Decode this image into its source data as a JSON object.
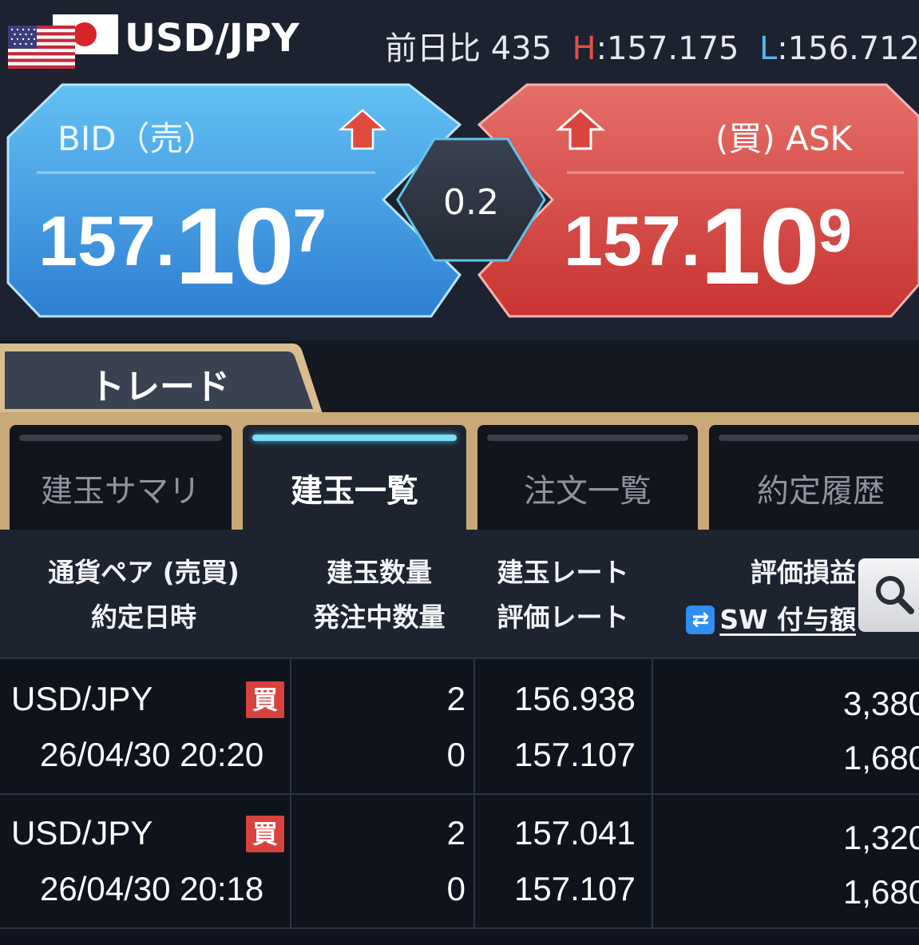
{
  "header": {
    "pair": "USD/JPY",
    "change_label": "前日比",
    "change_value": "435",
    "high_label": "H",
    "high_value": "157.175",
    "low_label": "L",
    "low_value": "156.712"
  },
  "quote": {
    "bid_label": "BID（売）",
    "ask_label": "(買) ASK",
    "bid_price_small": "157.",
    "bid_price_big": "10",
    "bid_price_sup": "7",
    "ask_price_small": "157.",
    "ask_price_big": "10",
    "ask_price_sup": "9",
    "spread": "0.2",
    "colors": {
      "bid": "#4aa3e6",
      "ask": "#d9443e",
      "up_arrow": "#e04a3f"
    }
  },
  "trade_tab": {
    "label": "トレード"
  },
  "subtabs": [
    {
      "label": "建玉サマリ",
      "active": false
    },
    {
      "label": "建玉一覧",
      "active": true
    },
    {
      "label": "注文一覧",
      "active": false
    },
    {
      "label": "約定履歴",
      "active": false
    }
  ],
  "table": {
    "headers": {
      "col1_line1": "通貨ペア (売買)",
      "col1_line2": "約定日時",
      "col2_line1": "建玉数量",
      "col2_line2": "発注中数量",
      "col3_line1": "建玉レート",
      "col3_line2": "評価レート",
      "col4_line1": "評価損益",
      "col4_line2": "SW 付与額",
      "sw_icon": "⇄"
    },
    "rows": [
      {
        "pair": "USD/JPY",
        "side": "買",
        "datetime": "26/04/30 20:20",
        "qty": "2",
        "pending": "0",
        "open_rate": "156.938",
        "eval_rate": "157.107",
        "pl": "3,380",
        "sw": "1,680"
      },
      {
        "pair": "USD/JPY",
        "side": "買",
        "datetime": "26/04/30 20:18",
        "qty": "2",
        "pending": "0",
        "open_rate": "157.041",
        "eval_rate": "157.107",
        "pl": "1,320",
        "sw": "1,680"
      }
    ]
  }
}
